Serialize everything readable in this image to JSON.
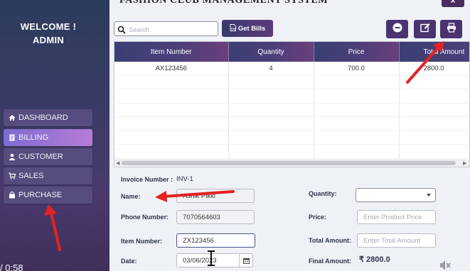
{
  "app": {
    "title": "FASHION CLUB MANAGEMENT SYSTEM",
    "close_label": "×"
  },
  "sidebar": {
    "welcome_line1": "WELCOME !",
    "welcome_line2": "ADMIN",
    "items": [
      {
        "label": "DASHBOARD",
        "icon": "home-icon"
      },
      {
        "label": "BILLING",
        "icon": "bill-icon",
        "active": true
      },
      {
        "label": "CUSTOMER",
        "icon": "user-icon"
      },
      {
        "label": "SALES",
        "icon": "cart-icon"
      },
      {
        "label": "PURCHASE",
        "icon": "bag-icon"
      }
    ]
  },
  "toolbar": {
    "search_placeholder": "Search",
    "get_bills_label": "Get Bills",
    "buttons": [
      "remove-icon",
      "edit-icon",
      "print-icon"
    ]
  },
  "table": {
    "columns": [
      "Item Number",
      "Quantity",
      "Price",
      "Total Amount"
    ],
    "rows": [
      [
        "AX123456",
        "4",
        "700.0",
        "2800.0"
      ]
    ]
  },
  "form": {
    "invoice_label": "Invoice Number :",
    "invoice_value": "INV-1",
    "name_label": "Name:",
    "name_value": "Ashik Pikki",
    "phone_label": "Phone Number:",
    "phone_value": "7070564603",
    "item_label": "Item Number:",
    "item_value": "ZX123456",
    "date_label": "Date:",
    "date_value": "03/06/2023",
    "quantity_label": "Quantity:",
    "quantity_value": "",
    "price_label": "Price:",
    "price_placeholder": "Enter Product Price",
    "total_label": "Total Amount:",
    "total_placeholder": "Enter Total Amount",
    "final_label": "Final Amount:",
    "final_value": "₹ 2800.0"
  },
  "video": {
    "time": "/ 0:58"
  },
  "colors": {
    "sidebar": "#3a3b66",
    "accent": "#4a3470",
    "annotation": "#e32222"
  }
}
